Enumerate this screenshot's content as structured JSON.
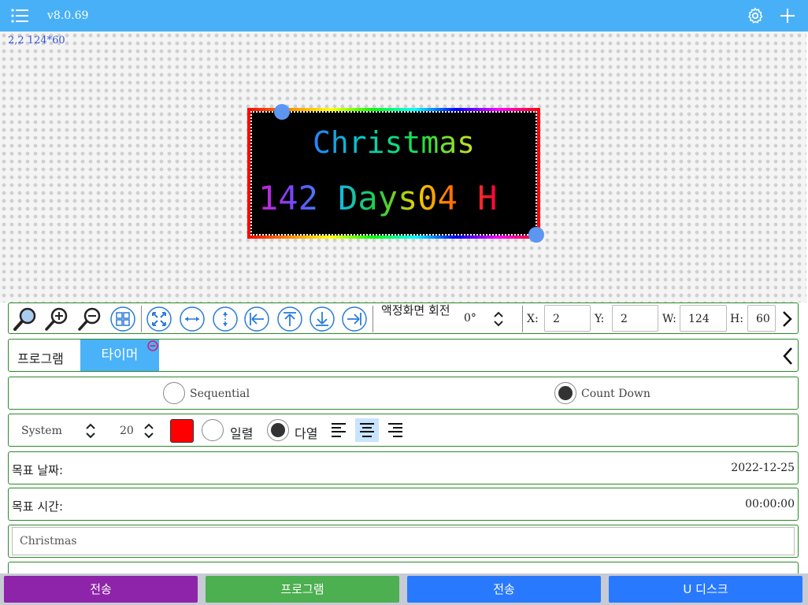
{
  "app": {
    "version": "v8.0.69"
  },
  "canvas": {
    "coords_readout": "2,2 124*60",
    "led_line1": "Christmas",
    "led_line2": "142 Days04 H"
  },
  "toolbar": {
    "rotation_label": "액정화면 회전",
    "rotation_value": "0°",
    "x_label": "X:",
    "x_value": "2",
    "y_label": "Y:",
    "y_value": "2",
    "w_label": "W:",
    "w_value": "124",
    "h_label": "H:",
    "h_value": "60"
  },
  "program": {
    "label": "프로그램",
    "active_tab": "타이머"
  },
  "mode": {
    "option_sequential": "Sequential",
    "option_countdown": "Count Down",
    "selected": "Count Down"
  },
  "format": {
    "font": "System",
    "size": "20",
    "color": "#ff0000",
    "single_line": "일렬",
    "multi_line": "다열",
    "line_selected": "다열",
    "align_selected": "center"
  },
  "target_date": {
    "label": "목표 날짜:",
    "value": "2022-12-25"
  },
  "target_time": {
    "label": "목표 시간:",
    "value": "00:00:00"
  },
  "title_input": {
    "value": "Christmas"
  },
  "bottom_buttons": [
    {
      "label": "전송",
      "color": "#8e24aa"
    },
    {
      "label": "프로그램",
      "color": "#4caf50"
    },
    {
      "label": "전송",
      "color": "#2979ff"
    },
    {
      "label": "U 디스크",
      "color": "#2979ff"
    }
  ]
}
